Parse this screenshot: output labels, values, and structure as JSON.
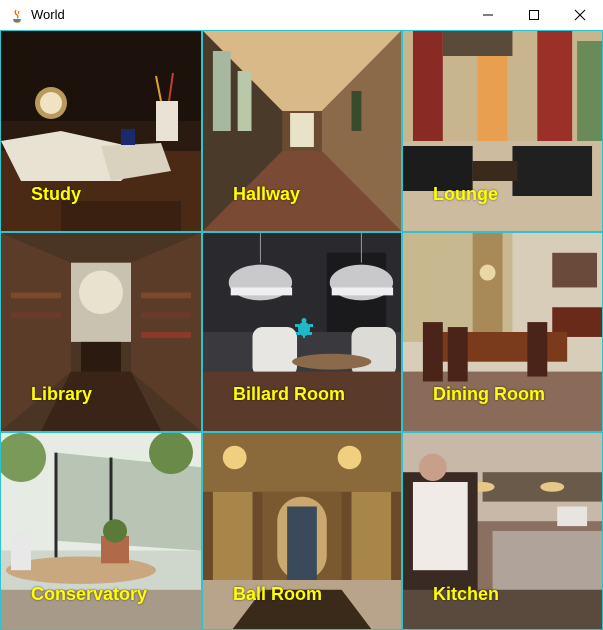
{
  "window": {
    "title": "World",
    "icon": "java-icon",
    "controls": [
      "minimize-icon",
      "maximize-icon",
      "close-icon"
    ]
  },
  "rooms": [
    {
      "label": "Study"
    },
    {
      "label": "Hallway"
    },
    {
      "label": "Lounge"
    },
    {
      "label": "Library"
    },
    {
      "label": "Billard Room"
    },
    {
      "label": "Dining Room"
    },
    {
      "label": "Conservatory"
    },
    {
      "label": "Ball Room"
    },
    {
      "label": "Kitchen"
    }
  ],
  "colors": {
    "grid_border": "#2bc4cf",
    "label_text": "#ffff00",
    "turtle": "#1fb8c8"
  },
  "player": {
    "icon": "turtle-icon",
    "room": "Billard Room"
  }
}
